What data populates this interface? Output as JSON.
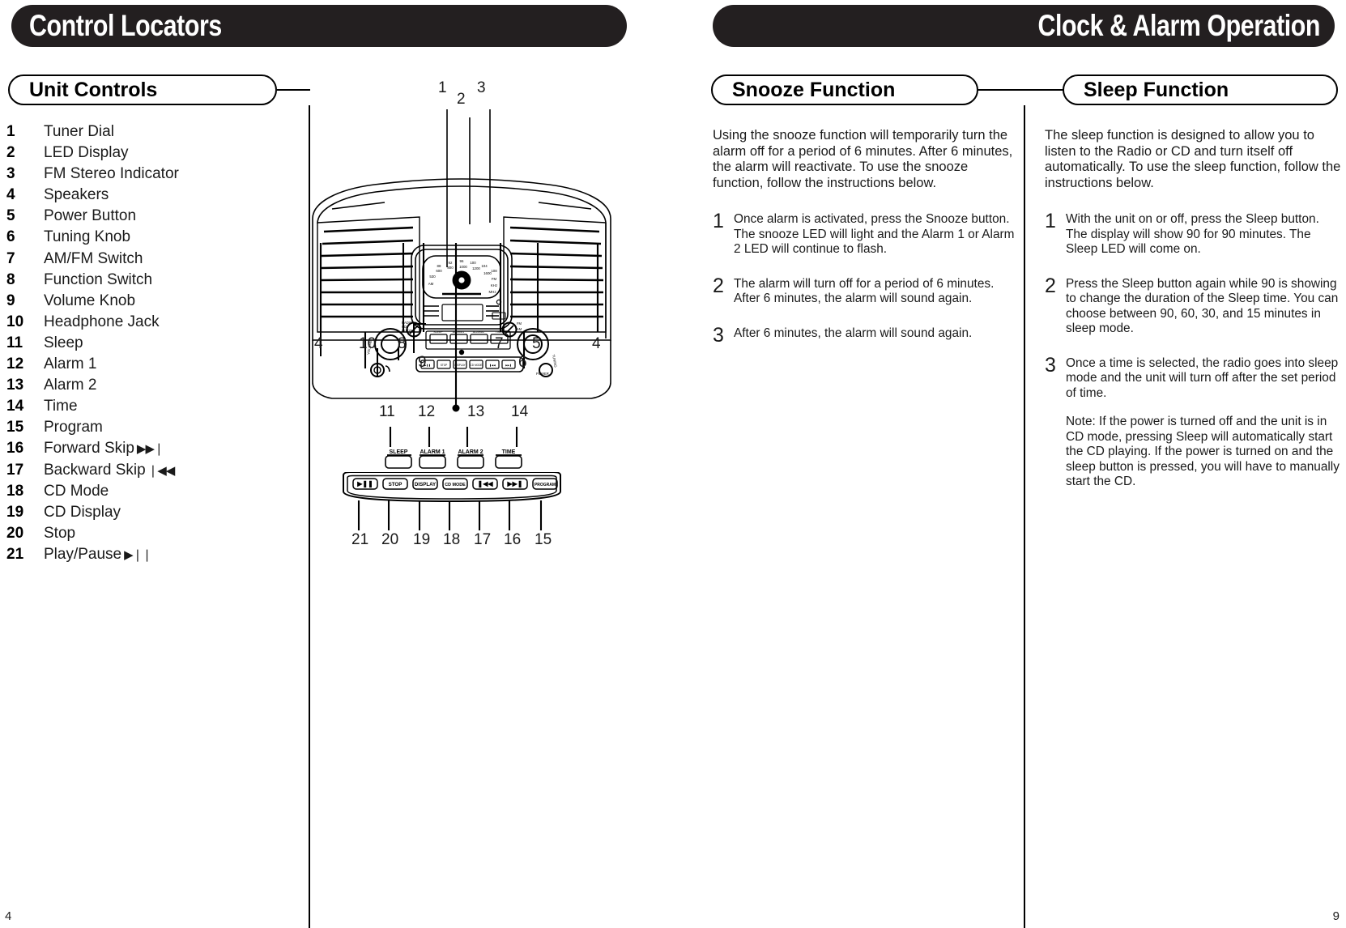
{
  "left_page": {
    "banner_title": "Control Locators",
    "section_title": "Unit Controls",
    "page_number": "4",
    "controls": [
      {
        "num": "1",
        "label": "Tuner Dial",
        "glyph": ""
      },
      {
        "num": "2",
        "label": "LED Display",
        "glyph": ""
      },
      {
        "num": "3",
        "label": "FM Stereo Indicator",
        "glyph": ""
      },
      {
        "num": "4",
        "label": "Speakers",
        "glyph": ""
      },
      {
        "num": "5",
        "label": "Power Button",
        "glyph": ""
      },
      {
        "num": "6",
        "label": "Tuning Knob",
        "glyph": ""
      },
      {
        "num": "7",
        "label": "AM/FM Switch",
        "glyph": ""
      },
      {
        "num": "8",
        "label": "Function Switch",
        "glyph": ""
      },
      {
        "num": "9",
        "label": "Volume Knob",
        "glyph": ""
      },
      {
        "num": "10",
        "label": "Headphone Jack",
        "glyph": ""
      },
      {
        "num": "11",
        "label": "Sleep",
        "glyph": ""
      },
      {
        "num": "12",
        "label": "Alarm 1",
        "glyph": ""
      },
      {
        "num": "13",
        "label": "Alarm 2",
        "glyph": ""
      },
      {
        "num": "14",
        "label": "Time",
        "glyph": ""
      },
      {
        "num": "15",
        "label": "Program",
        "glyph": ""
      },
      {
        "num": "16",
        "label": "Forward Skip",
        "glyph": "▶▶❘"
      },
      {
        "num": "17",
        "label": "Backward Skip",
        "glyph": "❘◀◀"
      },
      {
        "num": "18",
        "label": "CD Mode",
        "glyph": ""
      },
      {
        "num": "19",
        "label": "CD Display",
        "glyph": ""
      },
      {
        "num": "20",
        "label": "Stop",
        "glyph": ""
      },
      {
        "num": "21",
        "label": "Play/Pause",
        "glyph": "▶❘❘"
      }
    ]
  },
  "diagram": {
    "top_callouts": [
      "1",
      "2",
      "3"
    ],
    "mid_callouts": [
      "4",
      "10",
      "8",
      "9",
      "7",
      "5",
      "6",
      "4"
    ],
    "alarm_row_callouts": [
      "11",
      "12",
      "13",
      "14"
    ],
    "alarm_buttons": [
      "SLEEP",
      "ALARM 1",
      "ALARM 2",
      "TIME"
    ],
    "cd_callouts": [
      "21",
      "20",
      "19",
      "18",
      "17",
      "16",
      "15"
    ],
    "cd_buttons": [
      "▶❘❘",
      "STOP",
      "DISPLAY",
      "CD MODE",
      "❘◀◀",
      "▶▶❘",
      "PROGRAM"
    ],
    "knob_labels": {
      "volume": "VOLUME",
      "tuning": "TUNING",
      "power": "POWER",
      "stereo": "STEREO",
      "function": "RADIO CD BUZZER",
      "band": "FM AM"
    },
    "dial_scale_fm": [
      "88",
      "92",
      "96",
      "100",
      "104",
      "108"
    ],
    "dial_scale_am": [
      "530",
      "600",
      "800",
      "1000",
      "1200",
      "1600"
    ],
    "dial_band_fm": "FM MHz",
    "dial_band_am": "AM KHz"
  },
  "right_page": {
    "banner_title": "Clock & Alarm Operation",
    "page_number": "9",
    "snooze": {
      "section_title": "Snooze Function",
      "intro": "Using the snooze function will temporarily turn the alarm off for a period of 6 minutes. After 6 minutes, the alarm will reactivate.  To use the snooze function, follow the instructions below.",
      "steps": [
        {
          "num": "1",
          "text": "Once alarm is activated, press the Snooze button.  The snooze LED will light and the Alarm 1 or Alarm 2 LED will continue to flash."
        },
        {
          "num": "2",
          "text": "The alarm will turn off for a period of 6 minutes. After 6 minutes, the alarm will sound again."
        },
        {
          "num": "3",
          "text": "After 6 minutes, the alarm will sound again."
        }
      ]
    },
    "sleep": {
      "section_title": "Sleep Function",
      "intro": "The sleep function is designed to allow you to listen to the Radio or CD and turn itself off automatically. To use the sleep function, follow the instructions below.",
      "steps": [
        {
          "num": "1",
          "text": "With the unit on or off, press the Sleep button. The display will show 90 for 90 minutes. The Sleep LED will come on.",
          "note": ""
        },
        {
          "num": "2",
          "text": "Press the Sleep button again while 90 is showing to change the duration of the Sleep time. You can choose between 90, 60, 30, and 15 minutes in sleep mode.",
          "note": ""
        },
        {
          "num": "3",
          "text": "Once a time is selected, the radio goes into sleep mode and the unit will turn off after the set period of time.",
          "note": "Note:  If the power is turned off and the unit is in CD mode, pressing Sleep will automatically start the CD playing.  If the power is turned on and the sleep button is pressed, you will have to manually start the CD."
        }
      ]
    }
  }
}
